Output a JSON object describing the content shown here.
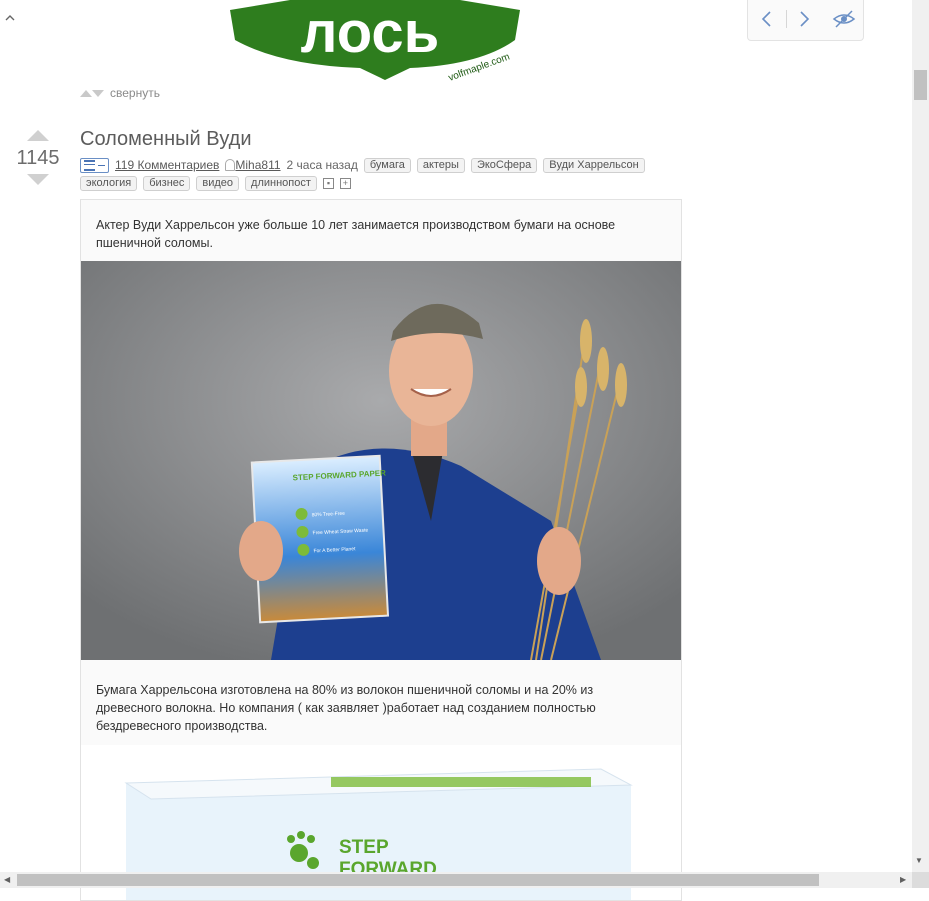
{
  "logo": {
    "text": "лось",
    "subtext": "volfmaple.com",
    "brand_color": "#2e7d1e"
  },
  "collapse": {
    "label": "свернуть"
  },
  "post": {
    "rating": "1145",
    "title": "Соломенный Вуди",
    "comments_link": "119 Комментариев",
    "author": "Miha811",
    "time": "2 часа назад",
    "tags": [
      "бумага",
      "актеры",
      "ЭкоСфера",
      "Вуди Харрельсон",
      "экология",
      "бизнес",
      "видео",
      "длиннопост"
    ],
    "paragraph1": "Актер Вуди Харрельсон уже больше 10 лет занимается производством бумаги на основе пшеничной соломы.",
    "paragraph2": "Бумага Харрельсона изготовлена на 80% из волокон пшеничной соломы и на 20% из древесного волокна. Но компания ( как заявляет )работает над созданием полностью бездревесного производства.",
    "paper_pack": {
      "brand": "STEP FORWARD PAPER",
      "features": [
        "80% Tree-Free",
        "Free Wheat Straw Waste",
        "For A Better Planet"
      ],
      "box_brand_line1": "STEP",
      "box_brand_line2": "FORWARD"
    }
  },
  "colors": {
    "accent": "#4a74b5",
    "nav_icon": "#6a8fc5"
  }
}
